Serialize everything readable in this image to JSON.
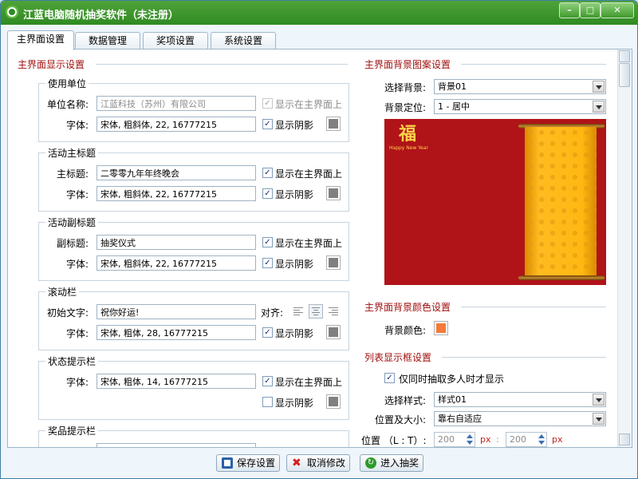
{
  "window": {
    "title": "江蓝电脑随机抽奖软件（未注册）"
  },
  "tabs": [
    {
      "label": "主界面设置",
      "active": true
    },
    {
      "label": "数据管理"
    },
    {
      "label": "奖项设置"
    },
    {
      "label": "系统设置"
    }
  ],
  "left": {
    "section_title": "主界面显示设置",
    "unit": {
      "title": "使用单位",
      "name_label": "单位名称:",
      "name_value": "江蓝科技（苏州）有限公司",
      "show_label": "显示在主界面上",
      "font_label": "字体:",
      "font_value": "宋体, 粗斜体, 22, 16777215",
      "shadow_label": "显示阴影"
    },
    "main_title": {
      "title": "活动主标题",
      "label": "主标题:",
      "value": "二零零九年年终晚会",
      "show_label": "显示在主界面上",
      "font_label": "字体:",
      "font_value": "宋体, 粗斜体, 22, 16777215",
      "shadow_label": "显示阴影"
    },
    "sub_title": {
      "title": "活动副标题",
      "label": "副标题:",
      "value": "抽奖仪式",
      "show_label": "显示在主界面上",
      "font_label": "字体:",
      "font_value": "宋体, 粗斜体, 22, 16777215",
      "shadow_label": "显示阴影"
    },
    "marquee": {
      "title": "滚动栏",
      "label": "初始文字:",
      "value": "祝你好运!",
      "align_label": "对齐:",
      "font_label": "字体:",
      "font_value": "宋体, 粗体, 28, 16777215",
      "shadow_label": "显示阴影"
    },
    "status_bar": {
      "title": "状态提示栏",
      "font_label": "字体:",
      "font_value": "宋体, 粗体, 14, 16777215",
      "show_label": "显示在主界面上",
      "shadow_label": "显示阴影"
    },
    "prize_bar": {
      "title": "奖品提示栏"
    }
  },
  "right": {
    "bg_section_title": "主界面背景图案设置",
    "bg_select_label": "选择背景:",
    "bg_select_value": "背景01",
    "bg_pos_label": "背景定位:",
    "bg_pos_value": "1 - 居中",
    "preview_text": "Happy New Year",
    "color_section_title": "主界面背景颜色设置",
    "color_label": "背景颜色:",
    "color_value": "#f47a38",
    "list_section_title": "列表显示框设置",
    "list_check_label": "仅同时抽取多人时才显示",
    "style_label": "选择样式:",
    "style_value": "样式01",
    "possize_label": "位置及大小:",
    "possize_value": "靠右自适应",
    "pos_label": "位置 （L : T）:",
    "pos_l": "200",
    "pos_t": "200",
    "px_unit": "px",
    "colon": ":"
  },
  "buttons": {
    "save": "保存设置",
    "cancel": "取消修改",
    "enter": "进入抽奖"
  },
  "colors": {
    "title_green": "#2f8a22",
    "section_red": "#a01010",
    "preview_red": "#b01318",
    "swatch_gray": "#808080"
  }
}
